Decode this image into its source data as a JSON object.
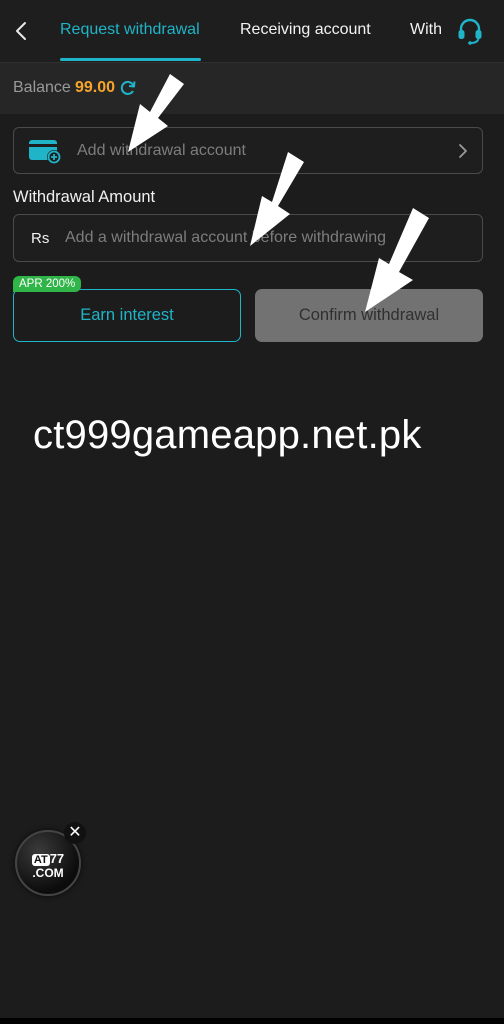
{
  "header": {
    "tabs": [
      {
        "label": "Request withdrawal",
        "active": true
      },
      {
        "label": "Receiving account",
        "active": false
      },
      {
        "label": "With",
        "active": false
      }
    ],
    "back_icon": "chevron-left-icon",
    "support_icon": "headset-icon"
  },
  "balance": {
    "label": "Balance",
    "value": "99.00",
    "refresh_icon": "refresh-icon"
  },
  "account": {
    "placeholder": "Add withdrawal account",
    "icon": "wallet-add-icon"
  },
  "amount": {
    "title": "Withdrawal Amount",
    "currency": "Rs",
    "placeholder": "Add a withdrawal account before withdrawing",
    "value": ""
  },
  "actions": {
    "apr_badge": "APR 200%",
    "earn_label": "Earn interest",
    "confirm_label": "Confirm withdrawal"
  },
  "watermark": "ct999gameapp.net.pk",
  "floating": {
    "logo_top_prefix": "AT",
    "logo_top_suffix": "77",
    "logo_bottom": ".COM",
    "close_label": "✕"
  },
  "colors": {
    "accent": "#1fb4c8",
    "balance": "#f4a52a",
    "badge": "#2fb548",
    "background": "#1c1c1c",
    "disabled_button": "#727272"
  }
}
